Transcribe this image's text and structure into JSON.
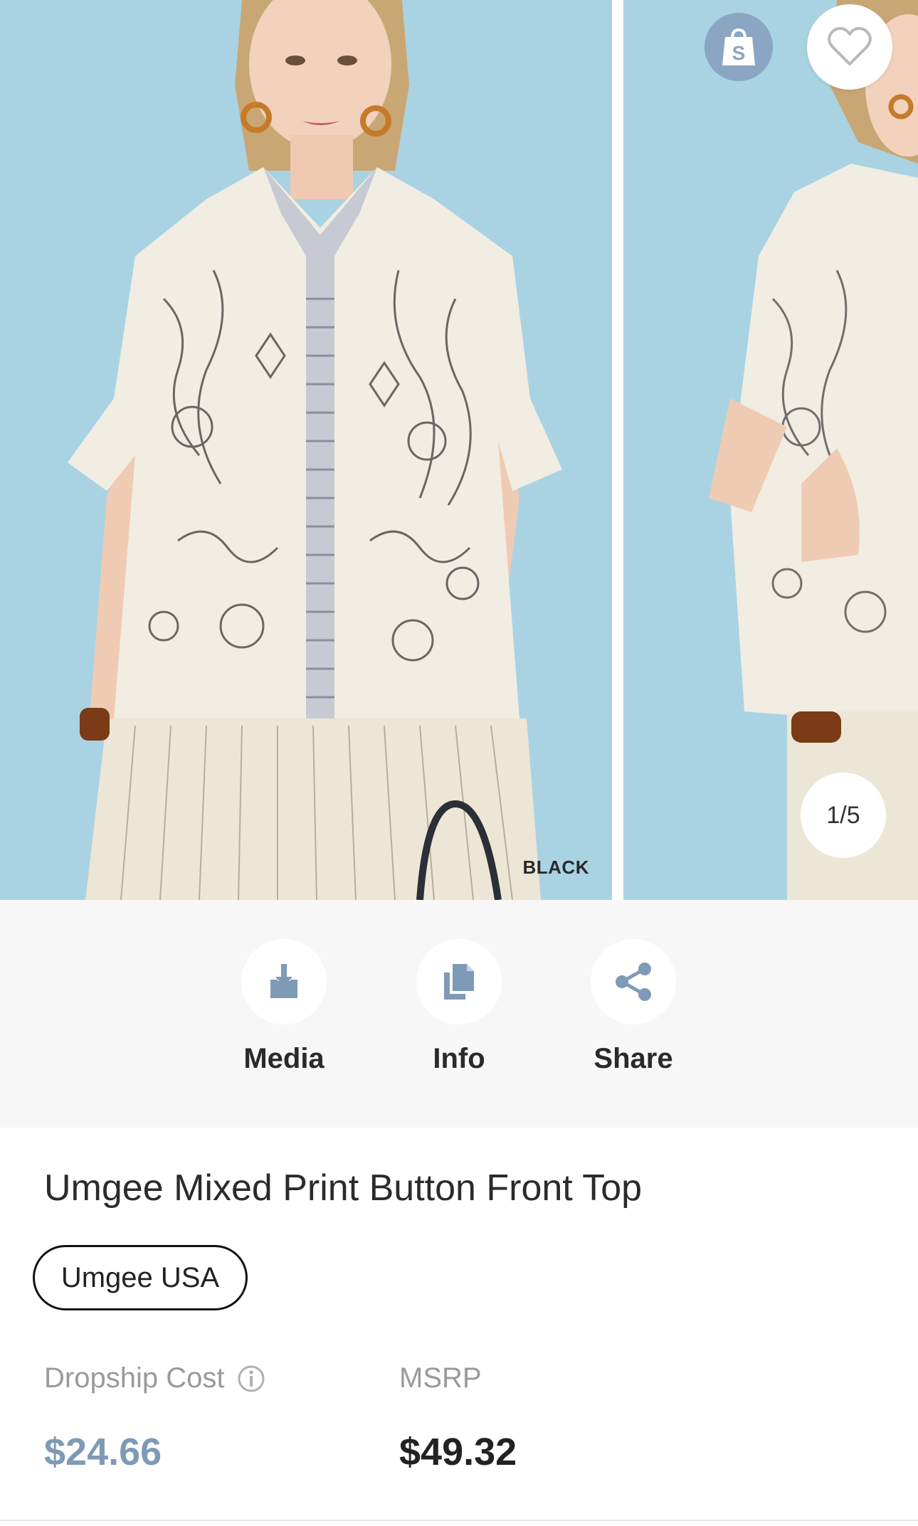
{
  "gallery": {
    "slide_count": 5,
    "current_slide": 1,
    "indicator_text": "1/5",
    "color_tag": "BLACK",
    "background_color": "#a9d3e3",
    "shop_badge_icon": "shopify-bag-icon",
    "favorite_icon": "heart-icon"
  },
  "actions": [
    {
      "id": "media",
      "label": "Media",
      "icon": "download-icon"
    },
    {
      "id": "info",
      "label": "Info",
      "icon": "documents-icon"
    },
    {
      "id": "share",
      "label": "Share",
      "icon": "share-icon"
    }
  ],
  "product": {
    "title": "Umgee Mixed Print Button Front Top",
    "brand": "Umgee USA",
    "dropship_cost_label": "Dropship Cost",
    "dropship_cost_value": "$24.66",
    "msrp_label": "MSRP",
    "msrp_value": "$49.32"
  },
  "colors": {
    "accent": "#7e9ab6",
    "action_bar_bg": "#f7f7f7",
    "icon_blue": "#7e9ab6"
  }
}
